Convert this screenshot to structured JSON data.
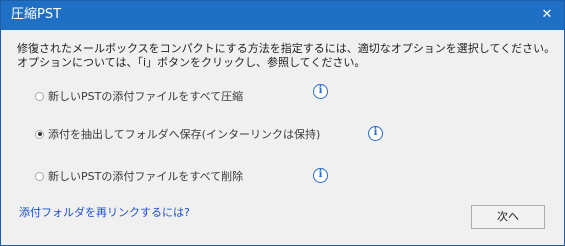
{
  "window": {
    "title": "圧縮PST",
    "close_glyph": "✕"
  },
  "description": {
    "line1": "修復されたメールボックスをコンパクトにする方法を指定するには、適切なオプションを選択してください。",
    "line2": "オプションについては、「i」ボタンをクリックし、参照してください。"
  },
  "options": [
    {
      "label": "新しいPSTの添付ファイルをすべて圧縮",
      "selected": false
    },
    {
      "label": "添付を抽出してフォルダへ保存(インターリンクは保持)",
      "selected": true
    },
    {
      "label": "新しいPSTの添付ファイルをすべて削除",
      "selected": false
    }
  ],
  "info_glyph": "i",
  "link": {
    "label": "添付フォルダを再リンクするには?"
  },
  "buttons": {
    "next_label": "次へ"
  },
  "colors": {
    "titlebar": "#1f6fc5",
    "background": "#f0f0f0",
    "link": "#1e4fd0",
    "info_icon": "#2a6cc8"
  }
}
